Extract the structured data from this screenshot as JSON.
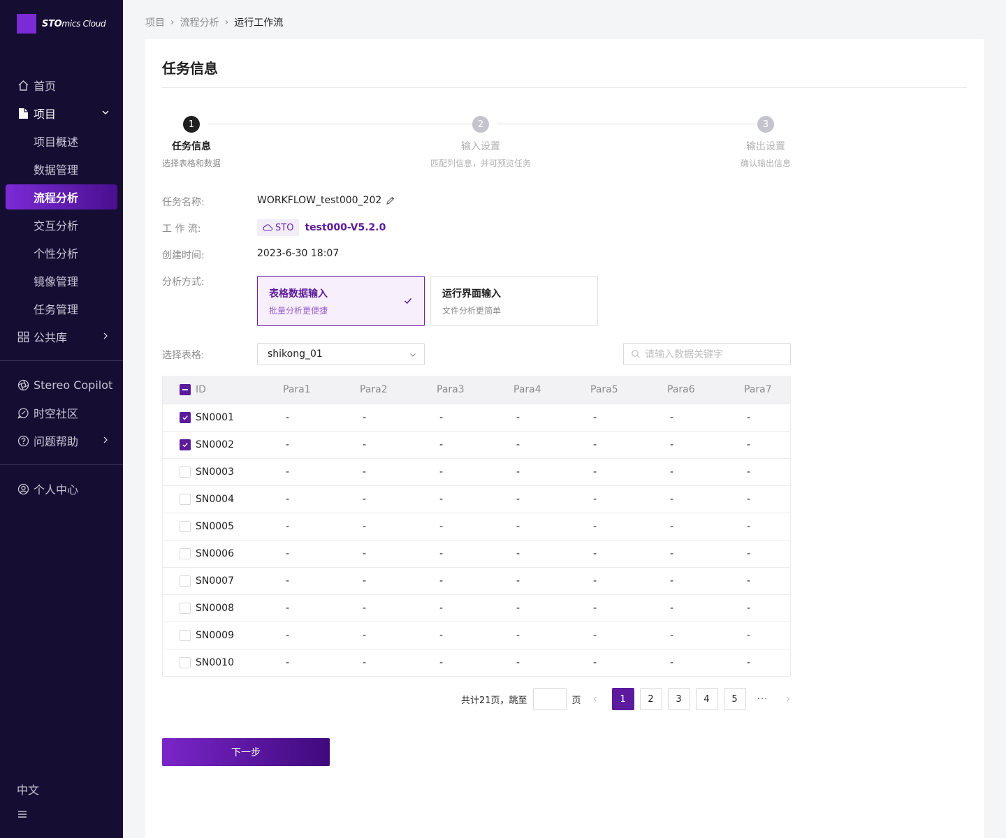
{
  "brand": {
    "strong": "STO",
    "light": "mics Cloud"
  },
  "sidebar": {
    "home": "首页",
    "project": "项目",
    "project_items": [
      "项目概述",
      "数据管理",
      "流程分析",
      "交互分析",
      "个性分析",
      "镜像管理",
      "任务管理"
    ],
    "public_lib": "公共库",
    "stereo": "Stereo Copilot",
    "community": "时空社区",
    "help": "问题帮助",
    "profile": "个人中心",
    "lang": "中文"
  },
  "breadcrumb": [
    "项目",
    "流程分析",
    "运行工作流"
  ],
  "page": {
    "title": "任务信息"
  },
  "steps": [
    {
      "num": "1",
      "label": "任务信息",
      "desc": "选择表格和数据"
    },
    {
      "num": "2",
      "label": "输入设置",
      "desc": "匹配列信息，并可预览任务"
    },
    {
      "num": "3",
      "label": "输出设置",
      "desc": "确认输出信息"
    }
  ],
  "form": {
    "task_name_label": "任务名称:",
    "task_name": "WORKFLOW_test000_202",
    "workflow_label": "工 作 流:",
    "workflow_tag": "STO",
    "workflow_name": "test000-V5.2.0",
    "created_label": "创建时间:",
    "created": "2023-6-30 18:07",
    "mode_label": "分析方式:",
    "modes": [
      {
        "title": "表格数据输入",
        "sub": "批量分析更便捷"
      },
      {
        "title": "运行界面输入",
        "sub": "文件分析更简单"
      }
    ],
    "table_label": "选择表格:",
    "table_value": "shikong_01",
    "search_placeholder": "请输入数据关键字"
  },
  "table": {
    "columns": [
      "ID",
      "Para1",
      "Para2",
      "Para3",
      "Para4",
      "Para5",
      "Para6",
      "Para7"
    ],
    "rows": [
      {
        "id": "SN0001",
        "checked": true
      },
      {
        "id": "SN0002",
        "checked": true
      },
      {
        "id": "SN0003",
        "checked": false
      },
      {
        "id": "SN0004",
        "checked": false
      },
      {
        "id": "SN0005",
        "checked": false
      },
      {
        "id": "SN0006",
        "checked": false
      },
      {
        "id": "SN0007",
        "checked": false
      },
      {
        "id": "SN0008",
        "checked": false
      },
      {
        "id": "SN0009",
        "checked": false
      },
      {
        "id": "SN0010",
        "checked": false
      }
    ],
    "empty": "-"
  },
  "pagination": {
    "summary": "共计21页，跳至",
    "page_unit": "页",
    "pages": [
      "1",
      "2",
      "3",
      "4",
      "5"
    ],
    "current": "1",
    "ellipsis": "···"
  },
  "actions": {
    "next": "下一步"
  },
  "colors": {
    "accent": "#5c1a9c",
    "sidebar_bg": "#160d33"
  }
}
